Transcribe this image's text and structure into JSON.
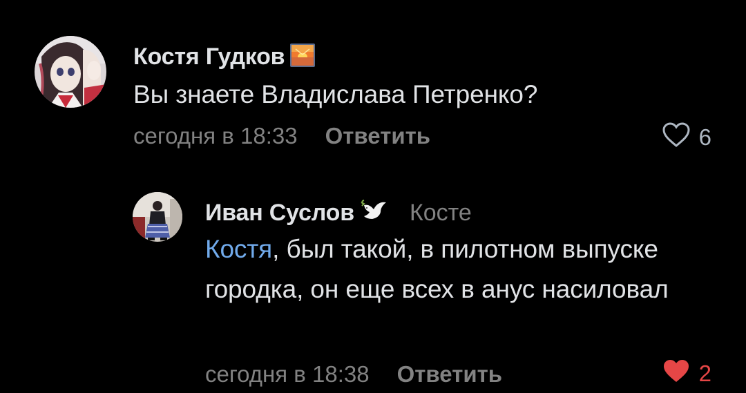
{
  "comments": [
    {
      "author": "Костя Гудков",
      "badge_icon": "sunset-badge-icon",
      "text": "Вы знаете Владислава Петренко?",
      "time": "сегодня в 18:33",
      "reply_label": "Ответить",
      "likes": "6",
      "liked": false,
      "like_color": "#aeb7c2"
    },
    {
      "author": "Иван Суслов",
      "badge_icon": "dove-icon",
      "reply_to": "Косте",
      "mention": "Костя",
      "text": ", был такой, в пилотном выпуске городка, он еще всех в анус насиловал",
      "time": "сегодня в 18:38",
      "reply_label": "Ответить",
      "likes": "2",
      "liked": true,
      "like_color": "#e64646"
    }
  ],
  "colors": {
    "background": "#000000",
    "text": "#e1e3e6",
    "secondary": "#828282",
    "mention": "#71aaeb",
    "liked": "#e64646"
  }
}
